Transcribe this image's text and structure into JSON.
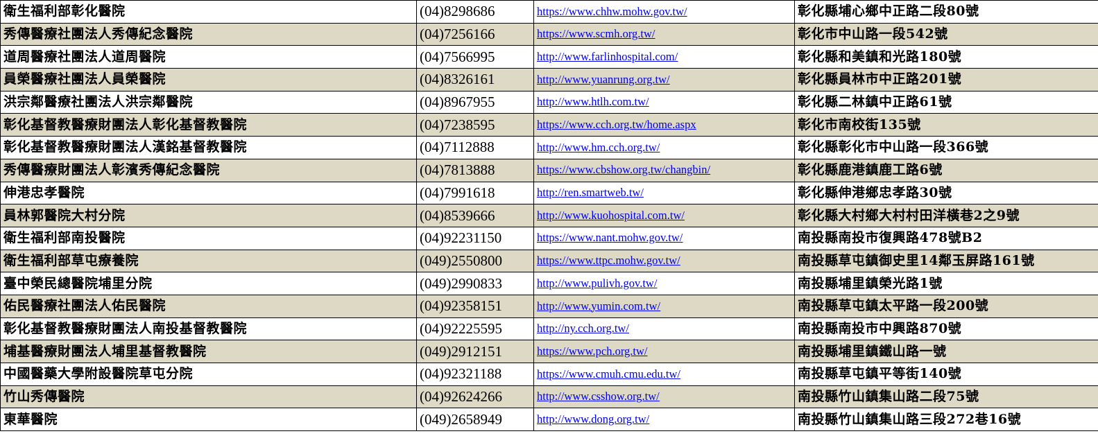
{
  "colors": {
    "row_shade": "#ddd9c4",
    "row_plain": "#ffffff",
    "link": "#0000ee",
    "border": "#000000"
  },
  "rows": [
    {
      "name": "衛生福利部彰化醫院",
      "phone": "(04)8298686",
      "url": "https://www.chhw.mohw.gov.tw/",
      "address": "彰化縣埔心鄉中正路二段80號"
    },
    {
      "name": "秀傳醫療社團法人秀傳紀念醫院",
      "phone": "(04)7256166",
      "url": "https://www.scmh.org.tw/",
      "address": "彰化市中山路一段542號"
    },
    {
      "name": "道周醫療社團法人道周醫院",
      "phone": "(04)7566995",
      "url": "http://www.farlinhospital.com/",
      "address": "彰化縣和美鎮和光路180號"
    },
    {
      "name": "員榮醫療社團法人員榮醫院",
      "phone": "(04)8326161",
      "url": "http://www.yuanrung.org.tw/",
      "address": "彰化縣員林市中正路201號"
    },
    {
      "name": "洪宗鄰醫療社團法人洪宗鄰醫院",
      "phone": "(04)8967955",
      "url": "http://www.htlh.com.tw/",
      "address": "彰化縣二林鎮中正路61號"
    },
    {
      "name": "彰化基督教醫療財團法人彰化基督教醫院",
      "phone": "(04)7238595",
      "url": "https://www.cch.org.tw/home.aspx",
      "address": "彰化市南校街135號"
    },
    {
      "name": "彰化基督教醫療財團法人漢銘基督教醫院",
      "phone": "(04)7112888",
      "url": "http://www.hm.cch.org.tw/",
      "address": "彰化縣彰化市中山路一段366號"
    },
    {
      "name": "秀傳醫療財團法人彰濱秀傳紀念醫院",
      "phone": "(04)7813888",
      "url": "https://www.cbshow.org.tw/changbin/",
      "address": "彰化縣鹿港鎮鹿工路6號"
    },
    {
      "name": "伸港忠孝醫院",
      "phone": "(04)7991618",
      "url": "http://ren.smartweb.tw/",
      "address": "彰化縣伸港鄉忠孝路30號"
    },
    {
      "name": "員林郭醫院大村分院",
      "phone": "(04)8539666",
      "url": "http://www.kuohospital.com.tw/",
      "address": "彰化縣大村鄉大村村田洋橫巷2之9號"
    },
    {
      "name": "衛生福利部南投醫院",
      "phone": "(04)92231150",
      "url": "https://www.nant.mohw.gov.tw/",
      "address": "南投縣南投市復興路478號B2"
    },
    {
      "name": "衛生福利部草屯療養院",
      "phone": "(049)2550800",
      "url": "https://www.ttpc.mohw.gov.tw/",
      "address": "南投縣草屯鎮御史里14鄰玉屏路161號"
    },
    {
      "name": "臺中榮民總醫院埔里分院",
      "phone": "(049)2990833",
      "url": "http://www.pulivh.gov.tw/",
      "address": "南投縣埔里鎮榮光路1號"
    },
    {
      "name": "佑民醫療社團法人佑民醫院",
      "phone": "(04)92358151",
      "url": "http://www.yumin.com.tw/",
      "address": "南投縣草屯鎮太平路一段200號"
    },
    {
      "name": "彰化基督教醫療財團法人南投基督教醫院",
      "phone": "(04)92225595",
      "url": "http://ny.cch.org.tw/",
      "address": "南投縣南投市中興路870號"
    },
    {
      "name": "埔基醫療財團法人埔里基督教醫院",
      "phone": "(049)2912151",
      "url": "https://www.pch.org.tw/",
      "address": "南投縣埔里鎮鐵山路一號"
    },
    {
      "name": "中國醫藥大學附設醫院草屯分院",
      "phone": "(04)92321188",
      "url": "https://www.cmuh.cmu.edu.tw/",
      "address": "南投縣草屯鎮平等街140號"
    },
    {
      "name": "竹山秀傳醫院",
      "phone": "(04)92624266",
      "url": "http://www.csshow.org.tw/",
      "address": "南投縣竹山鎮集山路二段75號"
    },
    {
      "name": "東華醫院",
      "phone": "(049)2658949",
      "url": "http://www.dong.org.tw/",
      "address": "南投縣竹山鎮集山路三段272巷16號"
    }
  ]
}
